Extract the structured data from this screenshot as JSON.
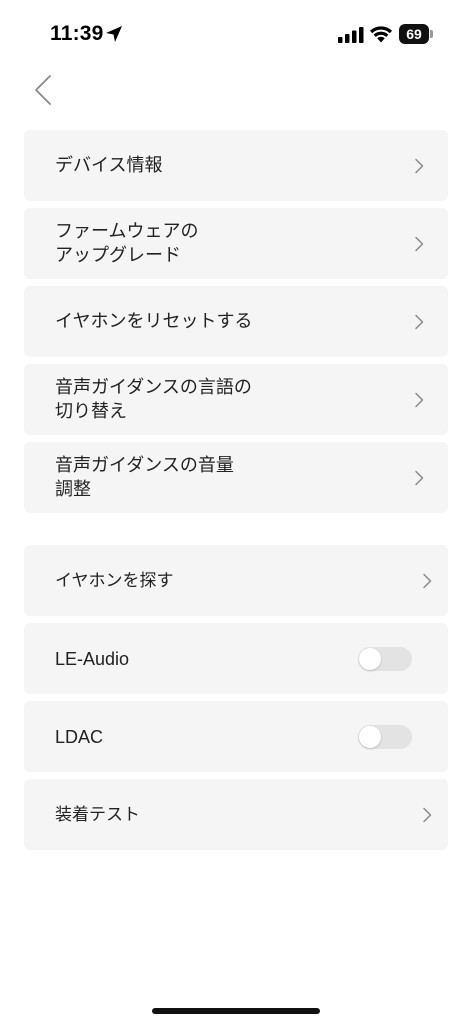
{
  "status_bar": {
    "time": "11:39",
    "battery_level": "69"
  },
  "navigation": {
    "back_icon": "chevron-left-icon"
  },
  "menu": {
    "device_info": "デバイス情報",
    "firmware_upgrade": "ファームウェアの\nアップグレード",
    "reset_earphones": "イヤホンをリセットする",
    "voice_guidance_language": "音声ガイダンスの言語の\n切り替え",
    "voice_guidance_volume": "音声ガイダンスの音量\n調整",
    "find_earphones": "イヤホンを探す",
    "le_audio": "LE-Audio",
    "ldac": "LDAC",
    "fit_test": "装着テスト"
  },
  "toggles": {
    "le_audio_enabled": false,
    "ldac_enabled": false
  },
  "colors": {
    "card_background": "#f5f5f5",
    "toggle_off": "#e3e3e3",
    "text": "#222222",
    "chevron": "#8a8a8a"
  }
}
